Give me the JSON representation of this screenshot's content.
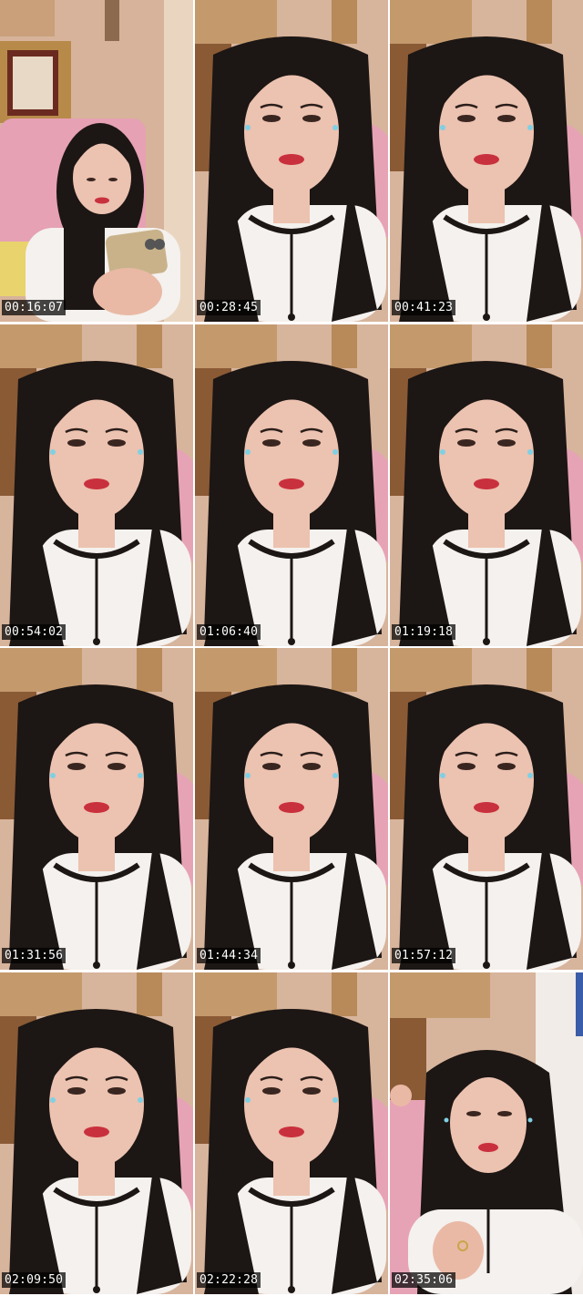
{
  "colors": {
    "wall": "#d7b49c",
    "wall_shadow": "#b8957e",
    "frame_gold": "#b8923f",
    "frame_dark": "#6a3d26",
    "pink_chair": "#e7a3b6",
    "pink_chair_shadow": "#cf8aa0",
    "hair": "#1c1614",
    "skin": "#ecc2b0",
    "lips": "#c9303d",
    "shirt": "#f4f1ee",
    "timestamp_bg": "#000000",
    "timestamp_text": "#ffffff"
  },
  "frames": [
    {
      "timestamp": "00:16:07",
      "variant": "phone"
    },
    {
      "timestamp": "00:28:45",
      "variant": "closeup"
    },
    {
      "timestamp": "00:41:23",
      "variant": "closeup"
    },
    {
      "timestamp": "00:54:02",
      "variant": "closeup"
    },
    {
      "timestamp": "01:06:40",
      "variant": "closeup"
    },
    {
      "timestamp": "01:19:18",
      "variant": "closeup"
    },
    {
      "timestamp": "01:31:56",
      "variant": "closeup"
    },
    {
      "timestamp": "01:44:34",
      "variant": "closeup"
    },
    {
      "timestamp": "01:57:12",
      "variant": "closeup"
    },
    {
      "timestamp": "02:09:50",
      "variant": "closeup"
    },
    {
      "timestamp": "02:22:28",
      "variant": "closeup"
    },
    {
      "timestamp": "02:35:06",
      "variant": "hand"
    }
  ]
}
